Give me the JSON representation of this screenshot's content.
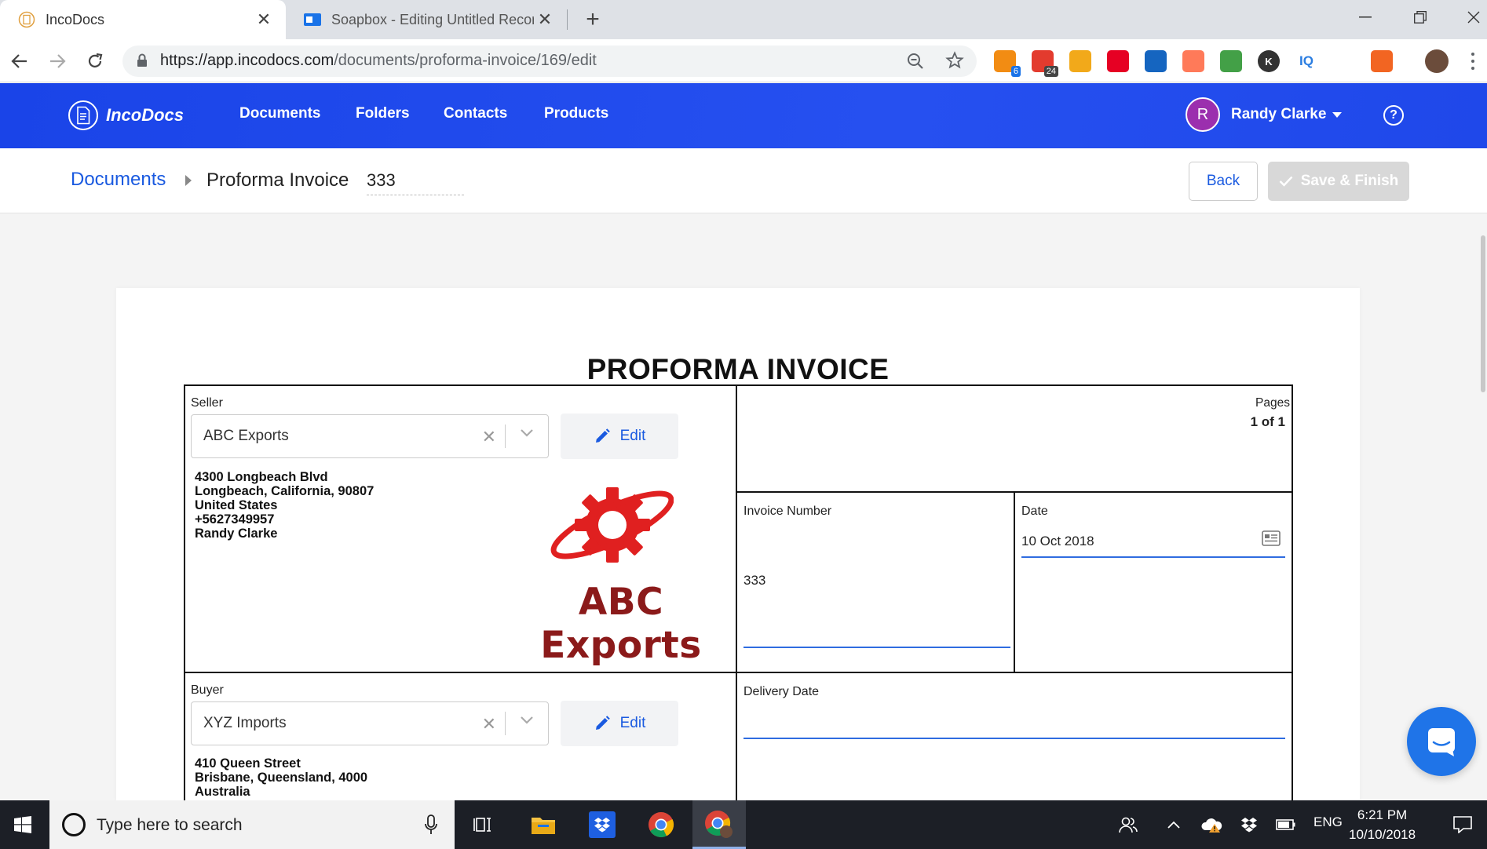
{
  "browser": {
    "tabs": [
      {
        "title": "IncoDocs",
        "active": true
      },
      {
        "title": "Soapbox - Editing Untitled Recor",
        "active": false
      }
    ],
    "url_host": "https://app.incodocs.com",
    "url_path": "/documents/proforma-invoice/169/edit",
    "extensions": [
      {
        "name": "extension-1-icon",
        "color": "#f28c13",
        "badge": "6",
        "badge_color": "#1a73e8"
      },
      {
        "name": "extension-2-icon",
        "color": "#e33b2e",
        "badge": "24",
        "badge_color": "#444444"
      },
      {
        "name": "honey-icon",
        "color": "#f2a91a"
      },
      {
        "name": "pinterest-icon",
        "color": "#e60023"
      },
      {
        "name": "extension-5-icon",
        "color": "#1565c0"
      },
      {
        "name": "hubspot-icon",
        "color": "#ff7a59"
      },
      {
        "name": "printer-extension-icon",
        "color": "#43a047"
      },
      {
        "name": "k-extension-icon",
        "color": "#333333",
        "label": "K"
      },
      {
        "name": "iq-extension-icon",
        "color": "#2a7de1",
        "label": "IQ"
      },
      {
        "name": "extension-10-icon",
        "color": "#4a8fd6"
      },
      {
        "name": "extension-11-icon",
        "color": "#f26522"
      }
    ]
  },
  "app": {
    "brand": "IncoDocs",
    "nav": [
      "Documents",
      "Folders",
      "Contacts",
      "Products"
    ],
    "user_initial": "R",
    "user_name": "Randy Clarke",
    "help": "?",
    "accent": "#1a44e8"
  },
  "breadcrumb": {
    "root": "Documents",
    "current": "Proforma Invoice",
    "number": "333"
  },
  "actions": {
    "back": "Back",
    "save": "Save & Finish"
  },
  "document": {
    "title": "PROFORMA INVOICE",
    "pages_label": "Pages",
    "pages_value": "1 of 1",
    "seller": {
      "label": "Seller",
      "value": "ABC Exports",
      "edit": "Edit",
      "address": [
        "4300 Longbeach Blvd",
        "Longbeach, California, 90807",
        "United States",
        "+5627349957",
        "Randy Clarke"
      ],
      "logo_text": "ABC Exports",
      "logo_color": "#e02020"
    },
    "invoice_number": {
      "label": "Invoice Number",
      "value": "333"
    },
    "date": {
      "label": "Date",
      "value": "10 Oct 2018"
    },
    "buyer": {
      "label": "Buyer",
      "value": "XYZ Imports",
      "edit": "Edit",
      "address": [
        "410 Queen Street",
        "Brisbane, Queensland, 4000",
        "Australia"
      ]
    },
    "delivery_date": {
      "label": "Delivery Date",
      "value": ""
    }
  },
  "taskbar": {
    "search_placeholder": "Type here to search",
    "language": "ENG",
    "time": "6:21 PM",
    "date": "10/10/2018"
  }
}
